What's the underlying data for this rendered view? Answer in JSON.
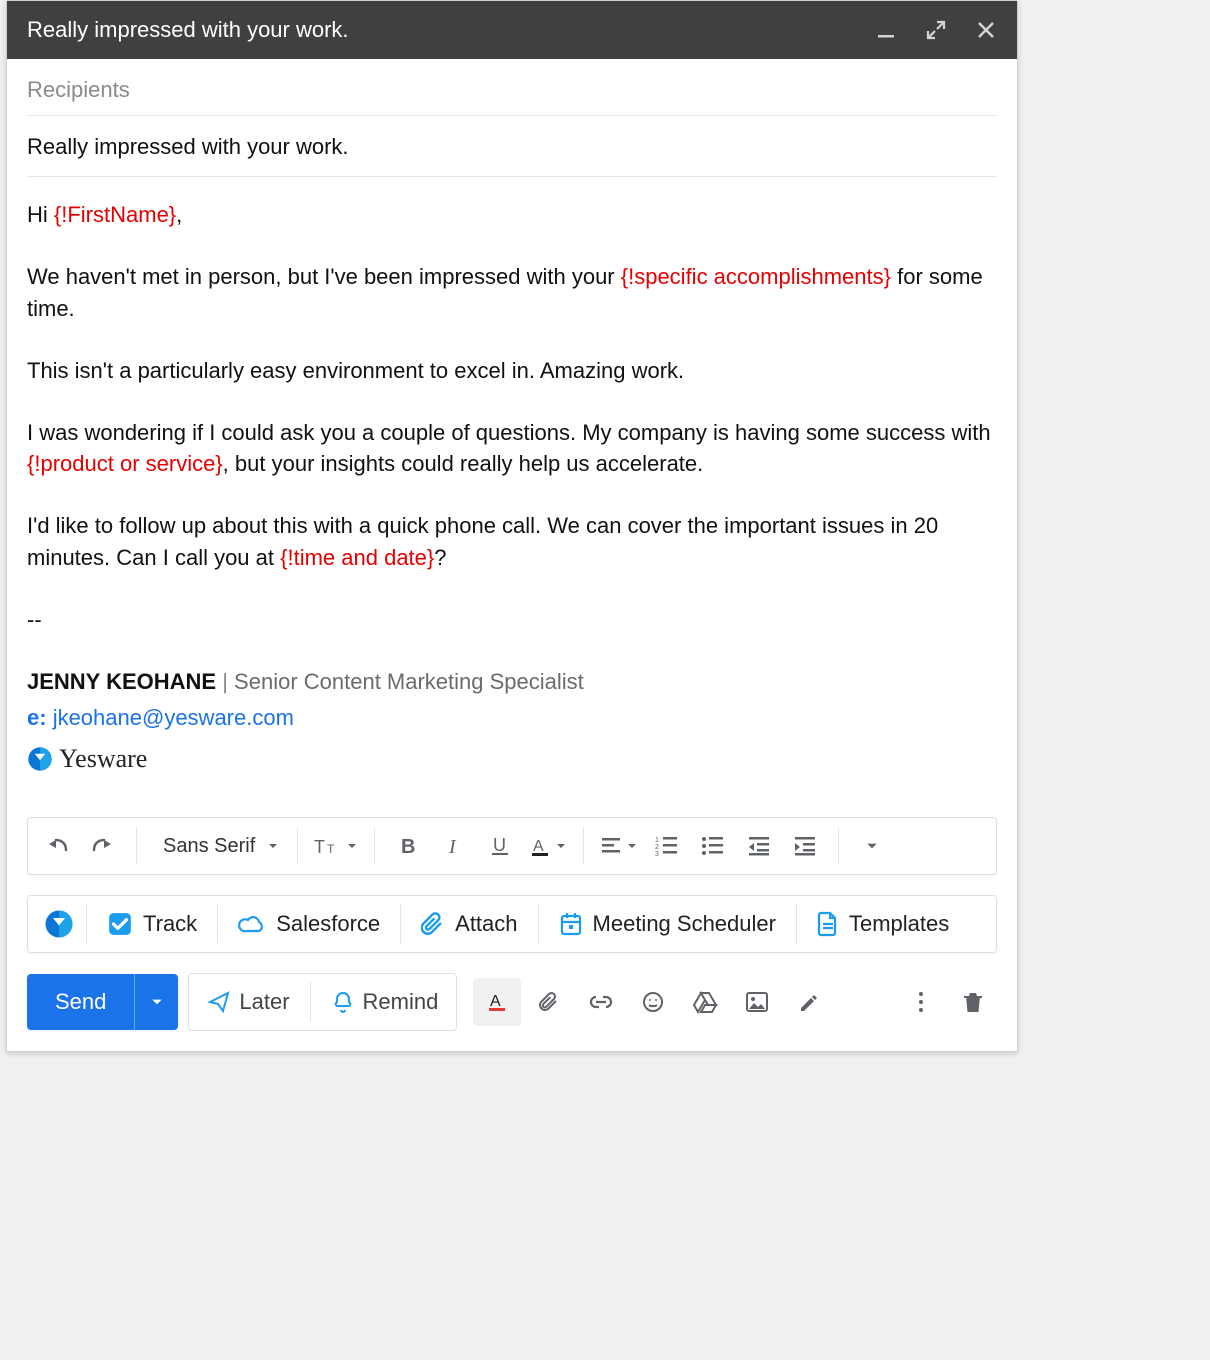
{
  "titlebar": {
    "title": "Really impressed with your work."
  },
  "recipients": {
    "placeholder": "Recipients"
  },
  "subject": {
    "value": "Really impressed with your work."
  },
  "body": {
    "greeting_prefix": "Hi ",
    "greeting_placeholder": "{!FirstName}",
    "greeting_suffix": ",",
    "p1_before": "We haven't met in person, but I've been impressed with your ",
    "p1_placeholder": "{!specific accomplishments}",
    "p1_after": " for some time.",
    "p2": "This isn't a particularly easy environment to excel in. Amazing work.",
    "p3_before": "I was wondering if I could ask you a couple of questions. My company is having some success with ",
    "p3_placeholder": "{!product or service}",
    "p3_after": ", but your insights could really help us accelerate.",
    "p4_before": "I'd like to follow up about this with a quick phone call. We can cover the important issues in 20 minutes. Can I call you at ",
    "p4_placeholder": "{!time and date}",
    "p4_after": "?",
    "sig_dashes": "--",
    "sig_name": "JENNY KEOHANE",
    "sig_sep": " | ",
    "sig_title": "Senior Content Marketing Specialist",
    "sig_email_label": "e: ",
    "sig_email": "jkeohane@yesware.com",
    "yesware_word": "Yesware"
  },
  "format_toolbar": {
    "font": "Sans Serif"
  },
  "yesware_bar": {
    "track": "Track",
    "salesforce": "Salesforce",
    "attach": "Attach",
    "meeting": "Meeting Scheduler",
    "templates": "Templates"
  },
  "send_row": {
    "send": "Send",
    "later": "Later",
    "remind": "Remind"
  }
}
